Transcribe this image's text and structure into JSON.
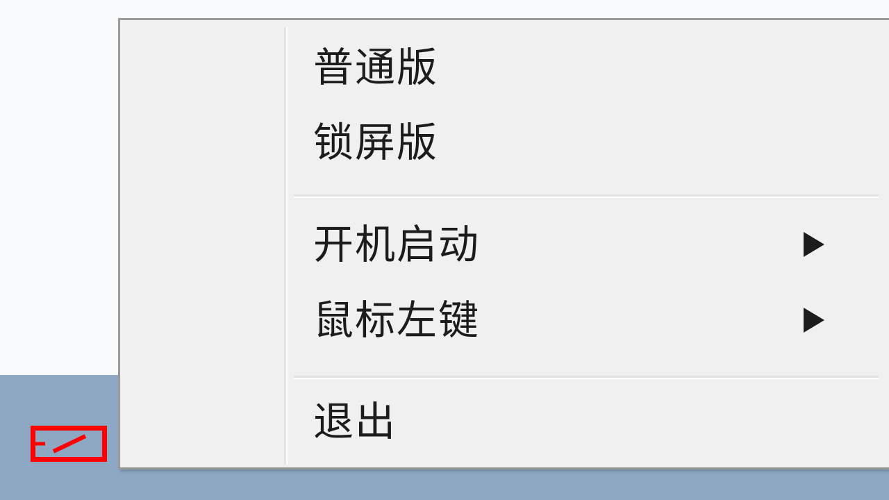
{
  "context_menu": {
    "items": [
      {
        "label": "普通版",
        "has_submenu": false
      },
      {
        "label": "锁屏版",
        "has_submenu": false
      },
      {
        "label": "开机启动",
        "has_submenu": true
      },
      {
        "label": "鼠标左键",
        "has_submenu": true
      },
      {
        "label": "退出",
        "has_submenu": false
      }
    ],
    "submenu_arrow_icon": "triangle-right-icon"
  },
  "taskbar": {
    "tray_icon": "app-tray-icon",
    "tray_icon_highlight_color": "#ff0000",
    "background_color": "#8ea8c4"
  },
  "desktop": {
    "background_color": "#f7f9fb"
  }
}
